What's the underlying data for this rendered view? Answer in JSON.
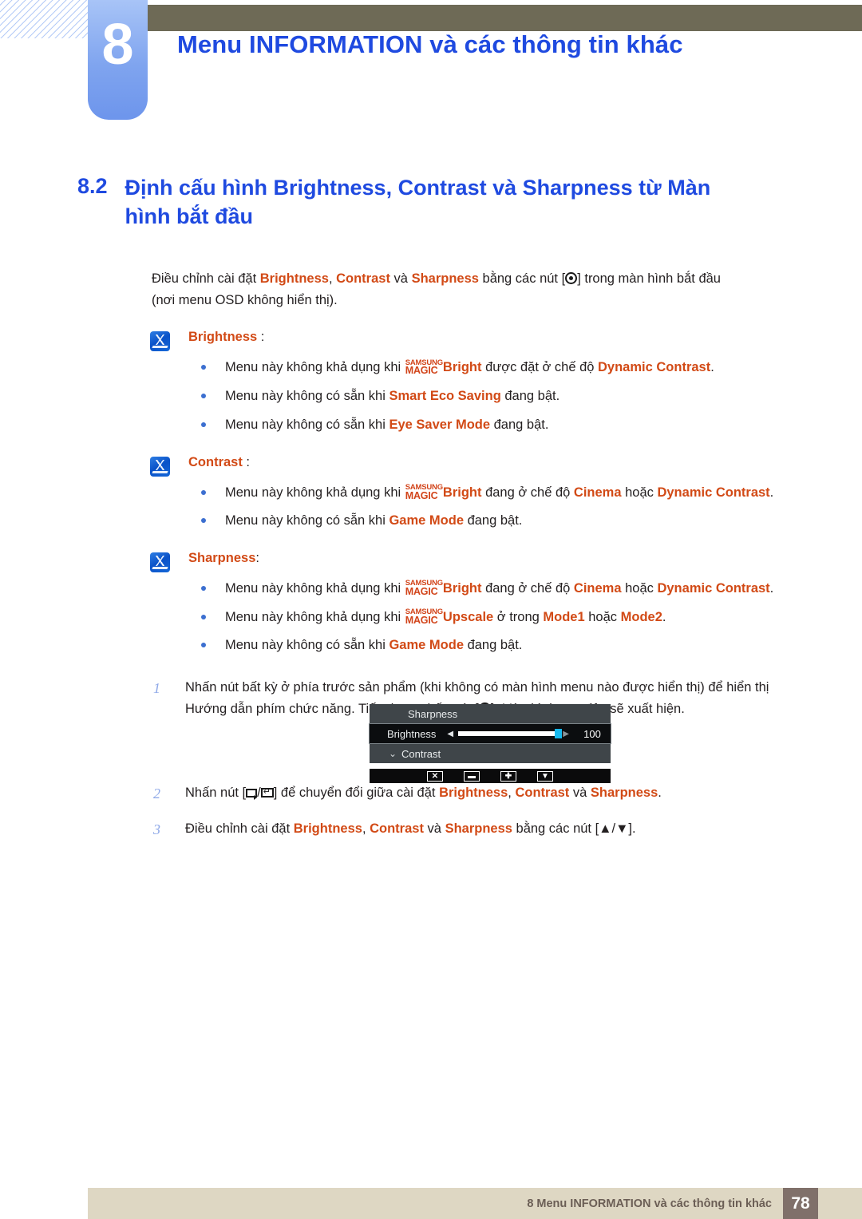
{
  "header": {
    "chapter_number": "8",
    "chapter_title": "Menu INFORMATION và các thông tin khác"
  },
  "section": {
    "number": "8.2",
    "title": "Định cấu hình Brightness, Contrast và Sharpness từ Màn hình bắt đầu"
  },
  "intro": {
    "line1_a": "Điều chỉnh cài đặt ",
    "kw_brightness": "Brightness",
    "sep1": ", ",
    "kw_contrast": "Contrast",
    "sep2": " và ",
    "kw_sharpness": "Sharpness",
    "line1_b": " bằng các nút [",
    "line1_c": "] trong màn hình bắt đầu",
    "line2": "(nơi menu OSD không hiển thị)."
  },
  "notes": [
    {
      "icon": "note-icon",
      "title": "Brightness",
      "colon": " :",
      "bullets": [
        {
          "pre": "Menu này không khả dụng khi ",
          "magic_top": "SAMSUNG",
          "magic_bottom": "MAGIC",
          "magic_word": "Bright",
          "mid": " được đặt ở chế độ ",
          "kw1": "Dynamic Contrast",
          "post": "."
        },
        {
          "pre": "Menu này không có sẵn khi ",
          "kw1": "Smart Eco Saving",
          "post": " đang bật."
        },
        {
          "pre": "Menu này không có sẵn khi ",
          "kw1": "Eye Saver Mode",
          "post": " đang bật."
        }
      ]
    },
    {
      "icon": "note-icon",
      "title": "Contrast",
      "colon": " :",
      "bullets": [
        {
          "pre": "Menu này không khả dụng khi ",
          "magic_top": "SAMSUNG",
          "magic_bottom": "MAGIC",
          "magic_word": "Bright",
          "mid": " đang ở chế độ ",
          "kw1": "Cinema",
          "mid2": " hoặc ",
          "kw2": "Dynamic Contrast",
          "post": "."
        },
        {
          "pre": "Menu này không có sẵn khi ",
          "kw1": "Game Mode",
          "post": " đang bật."
        }
      ]
    },
    {
      "icon": "note-icon",
      "title": "Sharpness",
      "colon": ":",
      "bullets": [
        {
          "pre": "Menu này không khả dụng khi ",
          "magic_top": "SAMSUNG",
          "magic_bottom": "MAGIC",
          "magic_word": "Bright",
          "mid": " đang ở chế độ ",
          "kw1": "Cinema",
          "mid2": " hoặc ",
          "kw2": "Dynamic Contrast",
          "post": "."
        },
        {
          "pre": "Menu này không khả dụng khi ",
          "magic_top": "SAMSUNG",
          "magic_bottom": "MAGIC",
          "magic_word": "Upscale",
          "mid": " ở trong ",
          "kw1": "Mode1",
          "mid2": " hoặc ",
          "kw2": "Mode2",
          "post": "."
        },
        {
          "pre": "Menu này không có sẵn khi ",
          "kw1": "Game Mode",
          "post": " đang bật."
        }
      ]
    }
  ],
  "steps": {
    "step1": {
      "num": "1",
      "text_a": "Nhấn nút bất kỳ ở phía trước sản phẩm (khi không có màn hình menu nào được hiển thị) để hiển thị Hướng dẫn phím chức năng. Tiếp theo, nhấn nút [",
      "text_b": "]. Màn hình sau đây sẽ xuất hiện."
    },
    "step2": {
      "num": "2",
      "text_a": "Nhấn nút [",
      "slash": "/",
      "text_b": "] để chuyển đổi giữa cài đặt ",
      "kw1": "Brightness",
      "sep1": ", ",
      "kw2": "Contrast",
      "sep2": " và ",
      "kw3": "Sharpness",
      "text_c": "."
    },
    "step3": {
      "num": "3",
      "text_a": "Điều chỉnh cài đặt ",
      "kw1": "Brightness",
      "sep1": ", ",
      "kw2": "Contrast",
      "sep2": " và ",
      "kw3": "Sharpness",
      "text_b": " bằng các nút [▲/▼]."
    }
  },
  "osd": {
    "row_sharpness": "Sharpness",
    "row_brightness": "Brightness",
    "row_contrast": "Contrast",
    "contrast_chevron": "⌄",
    "arrow_left": "◀",
    "arrow_right": "▶",
    "brightness_value": "100",
    "slider_percent": 100,
    "keys": [
      "✕",
      "▬",
      "✚",
      "▼"
    ],
    "colors": {
      "panel_bg": "#3f4549",
      "selected_bg": "#0b0d0f",
      "slider_knob": "#17b9ee",
      "bar_bg": "#0b0b0c"
    }
  },
  "footer": {
    "text": "8 Menu INFORMATION và các thông tin khác",
    "page": "78"
  },
  "colors": {
    "heading_blue": "#1f4ae0",
    "keyword_orange": "#d24a16",
    "chapter_tab": "#7fa4ef",
    "olive_bar": "#6e6a56",
    "footer_bg": "#ded7c3",
    "footer_page_bg": "#80706a"
  }
}
